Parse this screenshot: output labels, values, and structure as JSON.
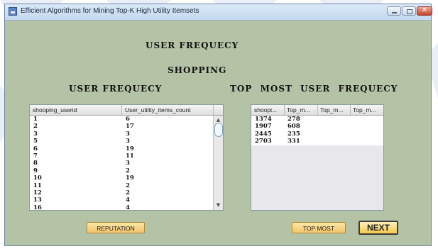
{
  "window": {
    "title": "Efficient Algorithms for Mining Top-K High Utility Itemsets"
  },
  "headings": {
    "main": "USER FREQUECY",
    "sub": "SHOPPING",
    "left": "USER FREQUECY",
    "right": "TOP MOST USER FREQUECY"
  },
  "left_table": {
    "columns": [
      "shooping_userid",
      "User_utility_items_count"
    ],
    "rows": [
      [
        "1",
        "6"
      ],
      [
        "2",
        "17"
      ],
      [
        "3",
        "3"
      ],
      [
        "5",
        "3"
      ],
      [
        "6",
        "19"
      ],
      [
        "7",
        "11"
      ],
      [
        "8",
        "3"
      ],
      [
        "9",
        "2"
      ],
      [
        "10",
        "19"
      ],
      [
        "11",
        "2"
      ],
      [
        "12",
        "2"
      ],
      [
        "13",
        "4"
      ],
      [
        "16",
        "4"
      ]
    ]
  },
  "right_table": {
    "columns": [
      "shoopi...",
      "Top_m...",
      "Top_m...",
      "Top_m..."
    ],
    "rows": [
      [
        "1374",
        "278"
      ],
      [
        "1907",
        "608"
      ],
      [
        "2445",
        "235"
      ],
      [
        "2703",
        "331"
      ]
    ]
  },
  "buttons": {
    "reputation": "REPUTATION",
    "top_most": "TOP MOST",
    "next": "NEXT"
  },
  "icons": {
    "scroll_up": "▲",
    "scroll_down": "▼",
    "close": "✕"
  }
}
